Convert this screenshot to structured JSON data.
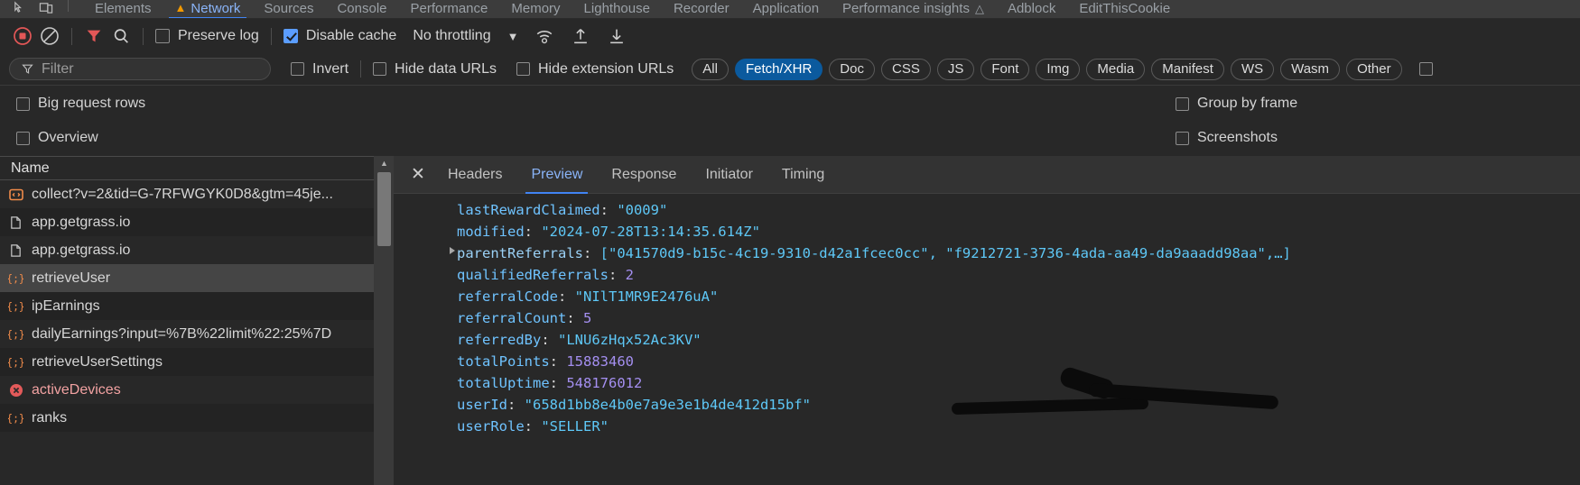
{
  "devtools": {
    "tabs": [
      {
        "label": "Elements",
        "active": false,
        "warn": false
      },
      {
        "label": "Network",
        "active": true,
        "warn": true
      },
      {
        "label": "Sources",
        "active": false,
        "warn": false
      },
      {
        "label": "Console",
        "active": false,
        "warn": false
      },
      {
        "label": "Performance",
        "active": false,
        "warn": false
      },
      {
        "label": "Memory",
        "active": false,
        "warn": false
      },
      {
        "label": "Lighthouse",
        "active": false,
        "warn": false
      },
      {
        "label": "Recorder",
        "active": false,
        "warn": false
      },
      {
        "label": "Application",
        "active": false,
        "warn": false
      },
      {
        "label": "Performance insights",
        "active": false,
        "warn": false
      },
      {
        "label": "Adblock",
        "active": false,
        "warn": false
      },
      {
        "label": "EditThisCookie",
        "active": false,
        "warn": false
      }
    ],
    "tab_icons": [
      "inspect-icon",
      "device-toolbar-icon"
    ]
  },
  "toolbar": {
    "record_icon": "record-stop-icon",
    "clear_icon": "clear-icon",
    "filter_icon": "funnel-icon",
    "search_icon": "search-icon",
    "preserve_log_label": "Preserve log",
    "preserve_log_checked": false,
    "disable_cache_label": "Disable cache",
    "disable_cache_checked": true,
    "throttling_label": "No throttling",
    "throttle_caret": "▼",
    "wifi_icon": "network-conditions-icon",
    "import_icon": "import-har-icon",
    "export_icon": "export-har-icon"
  },
  "filterbar": {
    "filter_placeholder": "Filter",
    "filter_value": "",
    "invert_label": "Invert",
    "invert_checked": false,
    "hide_data_urls_label": "Hide data URLs",
    "hide_data_urls_checked": false,
    "hide_ext_urls_label": "Hide extension URLs",
    "hide_ext_urls_checked": false,
    "types": [
      {
        "label": "All",
        "selected": false
      },
      {
        "label": "Fetch/XHR",
        "selected": true
      },
      {
        "label": "Doc",
        "selected": false
      },
      {
        "label": "CSS",
        "selected": false
      },
      {
        "label": "JS",
        "selected": false
      },
      {
        "label": "Font",
        "selected": false
      },
      {
        "label": "Img",
        "selected": false
      },
      {
        "label": "Media",
        "selected": false
      },
      {
        "label": "Manifest",
        "selected": false
      },
      {
        "label": "WS",
        "selected": false
      },
      {
        "label": "Wasm",
        "selected": false
      },
      {
        "label": "Other",
        "selected": false
      }
    ],
    "trailing_checkbox_checked": false
  },
  "settings": {
    "big_request_rows_label": "Big request rows",
    "big_request_rows_checked": false,
    "group_by_frame_label": "Group by frame",
    "group_by_frame_checked": false,
    "overview_label": "Overview",
    "overview_checked": false,
    "screenshots_label": "Screenshots",
    "screenshots_checked": false
  },
  "request_list": {
    "column_header": "Name",
    "rows": [
      {
        "name": "collect?v=2&tid=G-7RFWGYK0D8&gtm=45je...",
        "icon": "script-beacon-icon",
        "state": "normal"
      },
      {
        "name": "app.getgrass.io",
        "icon": "document-icon",
        "state": "normal"
      },
      {
        "name": "app.getgrass.io",
        "icon": "document-icon",
        "state": "normal"
      },
      {
        "name": "retrieveUser",
        "icon": "json-icon",
        "state": "selected"
      },
      {
        "name": "ipEarnings",
        "icon": "json-icon",
        "state": "normal"
      },
      {
        "name": "dailyEarnings?input=%7B%22limit%22:25%7D",
        "icon": "json-icon",
        "state": "normal"
      },
      {
        "name": "retrieveUserSettings",
        "icon": "json-icon",
        "state": "normal"
      },
      {
        "name": "activeDevices",
        "icon": "error-icon",
        "state": "error"
      },
      {
        "name": "ranks",
        "icon": "json-icon",
        "state": "normal"
      }
    ]
  },
  "detail": {
    "close_icon": "close-icon",
    "tabs": [
      {
        "label": "Headers",
        "active": false
      },
      {
        "label": "Preview",
        "active": true
      },
      {
        "label": "Response",
        "active": false
      },
      {
        "label": "Initiator",
        "active": false
      },
      {
        "label": "Timing",
        "active": false
      }
    ]
  },
  "preview_json": [
    {
      "key": "lastRewardClaimed",
      "value": "\"0009\"",
      "type": "string",
      "expandable": false
    },
    {
      "key": "modified",
      "value": "\"2024-07-28T13:14:35.614Z\"",
      "type": "string",
      "expandable": false
    },
    {
      "key": "parentReferrals",
      "value": "[\"041570d9-b15c-4c19-9310-d42a1fcec0cc\", \"f9212721-3736-4ada-aa49-da9aaadd98aa\",…]",
      "type": "array",
      "expandable": true
    },
    {
      "key": "qualifiedReferrals",
      "value": "2",
      "type": "number",
      "expandable": false
    },
    {
      "key": "referralCode",
      "value": "\"NIlT1MR9E2476uA\"",
      "type": "string",
      "expandable": false
    },
    {
      "key": "referralCount",
      "value": "5",
      "type": "number",
      "expandable": false
    },
    {
      "key": "referredBy",
      "value": "\"LNU6zHqx52Ac3KV\"",
      "type": "string",
      "expandable": false
    },
    {
      "key": "totalPoints",
      "value": "15883460",
      "type": "number",
      "expandable": false
    },
    {
      "key": "totalUptime",
      "value": "548176012",
      "type": "number",
      "expandable": false
    },
    {
      "key": "userId",
      "value": "\"658███████████████d15bf\"",
      "type": "string",
      "expandable": false,
      "redacted": true
    },
    {
      "key": "userRole",
      "value": "\"SELLER\"",
      "type": "string",
      "expandable": false
    }
  ],
  "colors": {
    "background": "#282828",
    "accent_blue": "#4184f3",
    "tab_active": "#8ab4f8",
    "pill_selected": "#0b5a9e",
    "json_key": "#6fc3ff",
    "json_string": "#5ec8f7",
    "json_number": "#a48ff0",
    "error_red": "#f2a2a2",
    "record_red": "#e35757"
  }
}
